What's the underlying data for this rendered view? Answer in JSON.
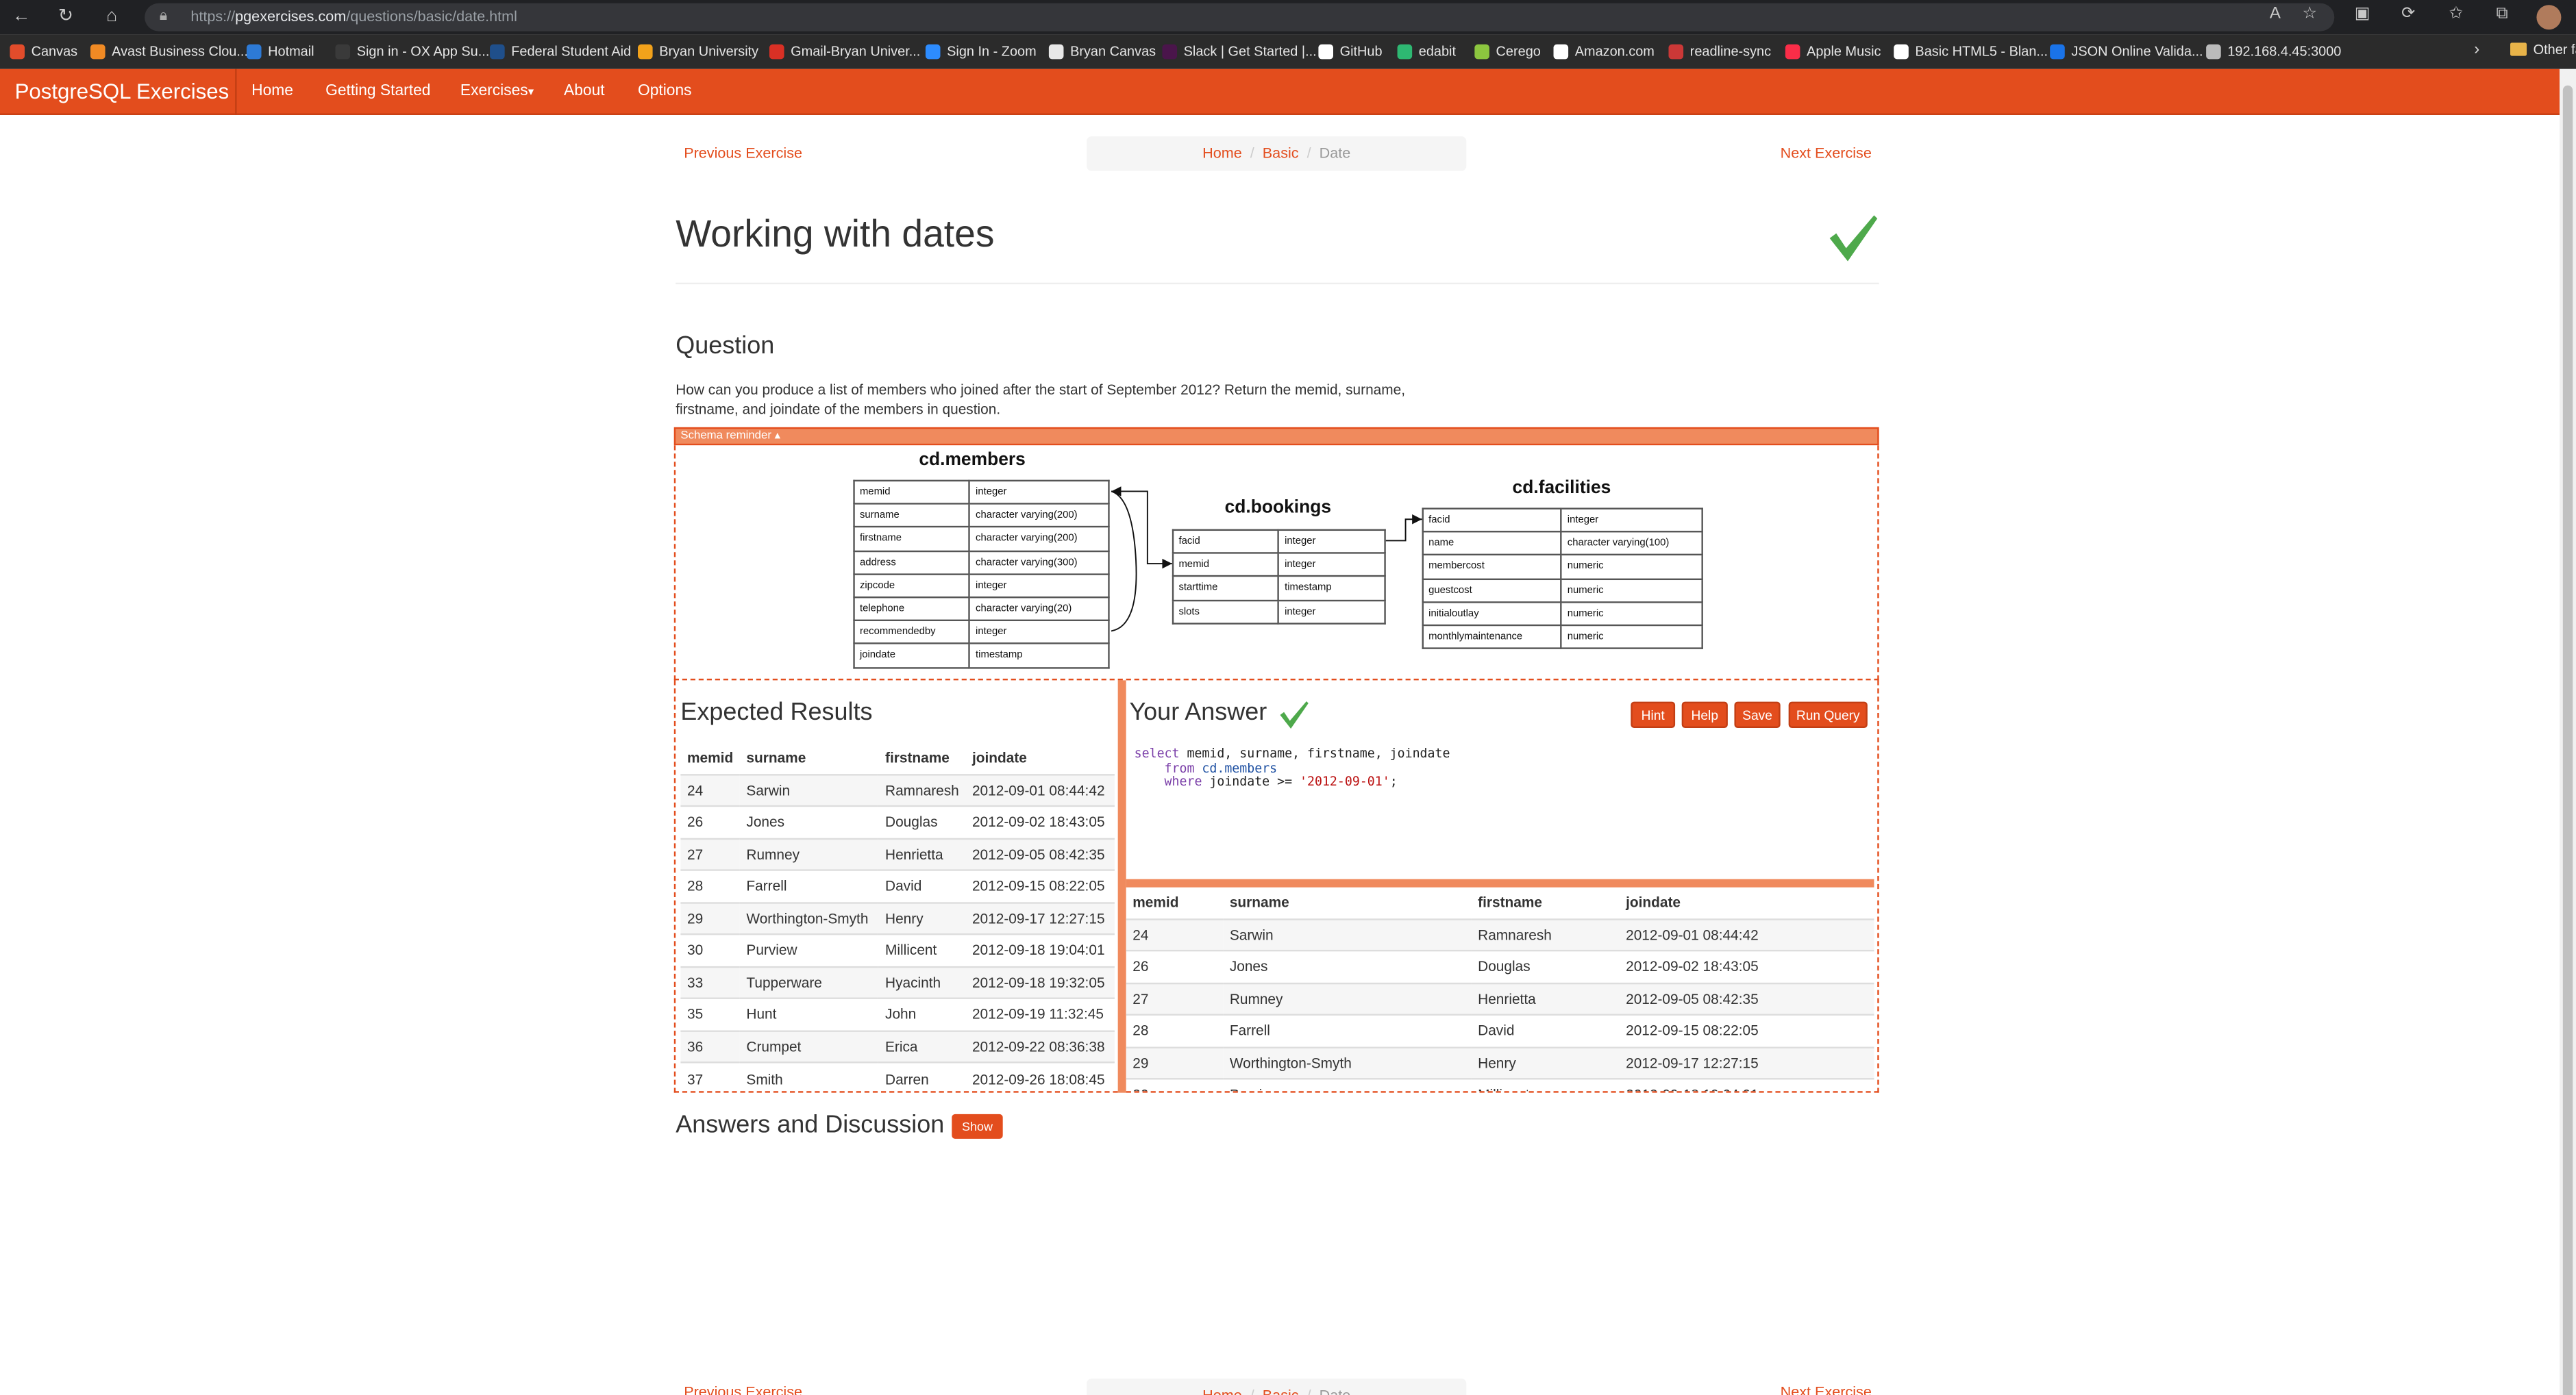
{
  "browser": {
    "url_prefix": "https://",
    "url_host": "pgexercises.com",
    "url_path": "/questions/basic/date.html",
    "bookmarks": [
      {
        "label": "Canvas",
        "color": "#e24c2b"
      },
      {
        "label": "Avast Business Clou...",
        "color": "#f08a24"
      },
      {
        "label": "Hotmail",
        "color": "#2d7ad6"
      },
      {
        "label": "Sign in - OX App Su...",
        "color": "#3a3a3a"
      },
      {
        "label": "Federal Student Aid",
        "color": "#1f4f8b"
      },
      {
        "label": "Bryan University",
        "color": "#f2a21b"
      },
      {
        "label": "Gmail-Bryan Univer...",
        "color": "#d93025"
      },
      {
        "label": "Sign In - Zoom",
        "color": "#2d8cff"
      },
      {
        "label": "Bryan Canvas",
        "color": "#e8e8e8"
      },
      {
        "label": "Slack | Get Started |...",
        "color": "#4a154b"
      },
      {
        "label": "GitHub",
        "color": "#ffffff"
      },
      {
        "label": "edabit",
        "color": "#2eb872"
      },
      {
        "label": "Cerego",
        "color": "#8cc63f"
      },
      {
        "label": "Amazon.com",
        "color": "#ffffff"
      },
      {
        "label": "readline-sync",
        "color": "#cb3837"
      },
      {
        "label": "Apple Music",
        "color": "#fa2d48"
      },
      {
        "label": "Basic HTML5 - Blan...",
        "color": "#ffffff"
      },
      {
        "label": "JSON Online Valida...",
        "color": "#1a73e8"
      },
      {
        "label": "192.168.4.45:3000",
        "color": "#bbbbbb"
      }
    ],
    "other_favorites": "Other fa"
  },
  "navbar": {
    "brand": "PostgreSQL Exercises",
    "items": [
      "Home",
      "Getting Started",
      "Exercises",
      "About",
      "Options"
    ],
    "exercises_caret": "▾"
  },
  "page": {
    "prev": "Previous Exercise",
    "next": "Next Exercise",
    "breadcrumb": [
      "Home",
      "Basic",
      "Date"
    ],
    "title": "Working with dates",
    "question_heading": "Question",
    "question_text": "How can you produce a list of members who joined after the start of September 2012? Return the memid, surname, firstname, and joindate of the members in question.",
    "schema_reminder": "Schema reminder ▴",
    "expected_heading": "Expected Results",
    "answer_heading": "Your Answer",
    "buttons": {
      "hint": "Hint",
      "help": "Help",
      "save": "Save",
      "run": "Run Query"
    },
    "discussion_heading": "Answers and Discussion",
    "show": "Show"
  },
  "schema": {
    "members": {
      "title": "cd.members",
      "rows": [
        [
          "memid",
          "integer"
        ],
        [
          "surname",
          "character varying(200)"
        ],
        [
          "firstname",
          "character varying(200)"
        ],
        [
          "address",
          "character varying(300)"
        ],
        [
          "zipcode",
          "integer"
        ],
        [
          "telephone",
          "character varying(20)"
        ],
        [
          "recommendedby",
          "integer"
        ],
        [
          "joindate",
          "timestamp"
        ]
      ]
    },
    "bookings": {
      "title": "cd.bookings",
      "rows": [
        [
          "facid",
          "integer"
        ],
        [
          "memid",
          "integer"
        ],
        [
          "starttime",
          "timestamp"
        ],
        [
          "slots",
          "integer"
        ]
      ]
    },
    "facilities": {
      "title": "cd.facilities",
      "rows": [
        [
          "facid",
          "integer"
        ],
        [
          "name",
          "character varying(100)"
        ],
        [
          "membercost",
          "numeric"
        ],
        [
          "guestcost",
          "numeric"
        ],
        [
          "initialoutlay",
          "numeric"
        ],
        [
          "monthlymaintenance",
          "numeric"
        ]
      ]
    }
  },
  "query": {
    "l1_kw": "select",
    "l1_rest": " memid, surname, firstname, joindate",
    "l2_kw": "from",
    "l2_rest": " cd.members",
    "l3_kw": "where",
    "l3_rest": " joindate >= ",
    "l3_str": "'2012-09-01'",
    "l3_end": ";"
  },
  "results": {
    "columns": [
      "memid",
      "surname",
      "firstname",
      "joindate"
    ],
    "rows": [
      [
        "24",
        "Sarwin",
        "Ramnaresh",
        "2012-09-01 08:44:42"
      ],
      [
        "26",
        "Jones",
        "Douglas",
        "2012-09-02 18:43:05"
      ],
      [
        "27",
        "Rumney",
        "Henrietta",
        "2012-09-05 08:42:35"
      ],
      [
        "28",
        "Farrell",
        "David",
        "2012-09-15 08:22:05"
      ],
      [
        "29",
        "Worthington-Smyth",
        "Henry",
        "2012-09-17 12:27:15"
      ],
      [
        "30",
        "Purview",
        "Millicent",
        "2012-09-18 19:04:01"
      ],
      [
        "33",
        "Tupperware",
        "Hyacinth",
        "2012-09-18 19:32:05"
      ],
      [
        "35",
        "Hunt",
        "John",
        "2012-09-19 11:32:45"
      ],
      [
        "36",
        "Crumpet",
        "Erica",
        "2012-09-22 08:36:38"
      ],
      [
        "37",
        "Smith",
        "Darren",
        "2012-09-26 18:08:45"
      ]
    ]
  },
  "colors": {
    "accent": "#e34d1d",
    "accent_light": "#f08a5d",
    "check": "#4ea94b"
  }
}
